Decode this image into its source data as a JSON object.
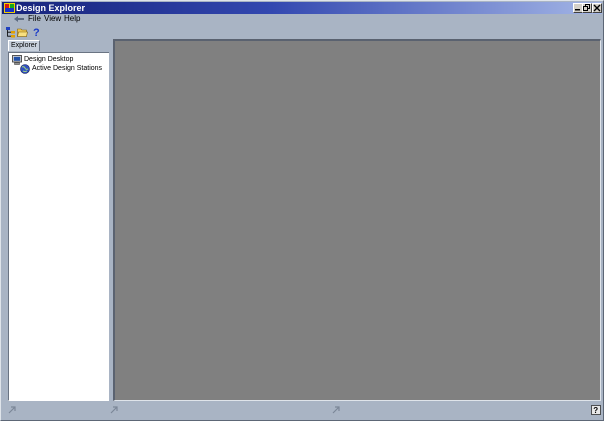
{
  "window": {
    "title": "Design Explorer",
    "caption_buttons": {
      "minimize": "minimize",
      "restore": "restore",
      "close": "close"
    }
  },
  "menu": {
    "items": [
      {
        "label": "File"
      },
      {
        "label": "View"
      },
      {
        "label": "Help"
      }
    ]
  },
  "toolbar": {
    "buttons": [
      {
        "icon": "tree-view-icon"
      },
      {
        "icon": "open-folder-icon"
      },
      {
        "icon": "help-icon"
      }
    ]
  },
  "explorer": {
    "tab_label": "Explorer",
    "tree": [
      {
        "label": "Design Desktop",
        "icon": "desktop-icon"
      },
      {
        "label": "Active Design Stations",
        "icon": "globe-icon"
      }
    ]
  },
  "colors": {
    "title_gradient_start": "#16227a",
    "title_gradient_end": "#a4b6e6",
    "frame": "#a9b4c4",
    "workspace": "#808080"
  }
}
